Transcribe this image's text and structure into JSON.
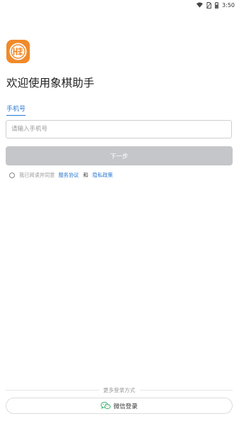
{
  "status_bar": {
    "time": "3:50",
    "icons": [
      "wifi-icon",
      "no-sim-icon",
      "battery-icon"
    ]
  },
  "app": {
    "logo_icon": "chess-piece-logo-icon",
    "logo_color": "#f08a2a",
    "welcome_text": "欢迎使用象棋助手"
  },
  "login": {
    "tab_label": "手机号",
    "phone_placeholder": "请输入手机号",
    "phone_value": "",
    "next_button_label": "下一步",
    "agreement": {
      "prefix": "我已阅读并同意",
      "service_link": "服务协议",
      "and_text": "和",
      "privacy_link": "隐私政策",
      "checked": false
    }
  },
  "more_login": {
    "divider_label": "更多登录方式",
    "wechat_icon": "wechat-icon",
    "wechat_label": "微信登录"
  },
  "colors": {
    "accent": "#2b78d0",
    "button_disabled": "#c4c6c9",
    "wechat_green": "#3cb371"
  }
}
